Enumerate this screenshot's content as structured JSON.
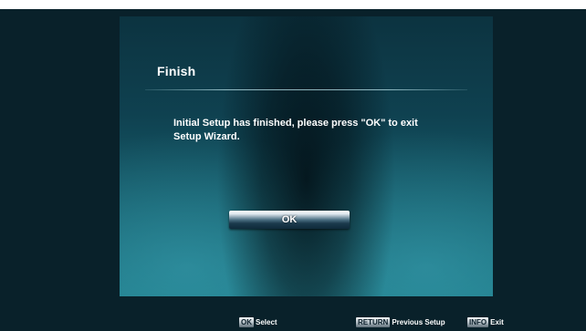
{
  "dialog": {
    "title": "Finish",
    "message": "Initial Setup has finished, please press \"OK\" to exit Setup Wizard.",
    "ok_label": "OK"
  },
  "footer": {
    "ok_key": "OK",
    "ok_action": "Select",
    "return_key": "RETURN",
    "return_action": "Previous Setup",
    "info_key": "INFO",
    "info_action": "Exit"
  },
  "colors": {
    "background": "#09212a",
    "panel_top": "#0c3340",
    "panel_bottom": "#1d7986",
    "text": "#ffffff"
  }
}
